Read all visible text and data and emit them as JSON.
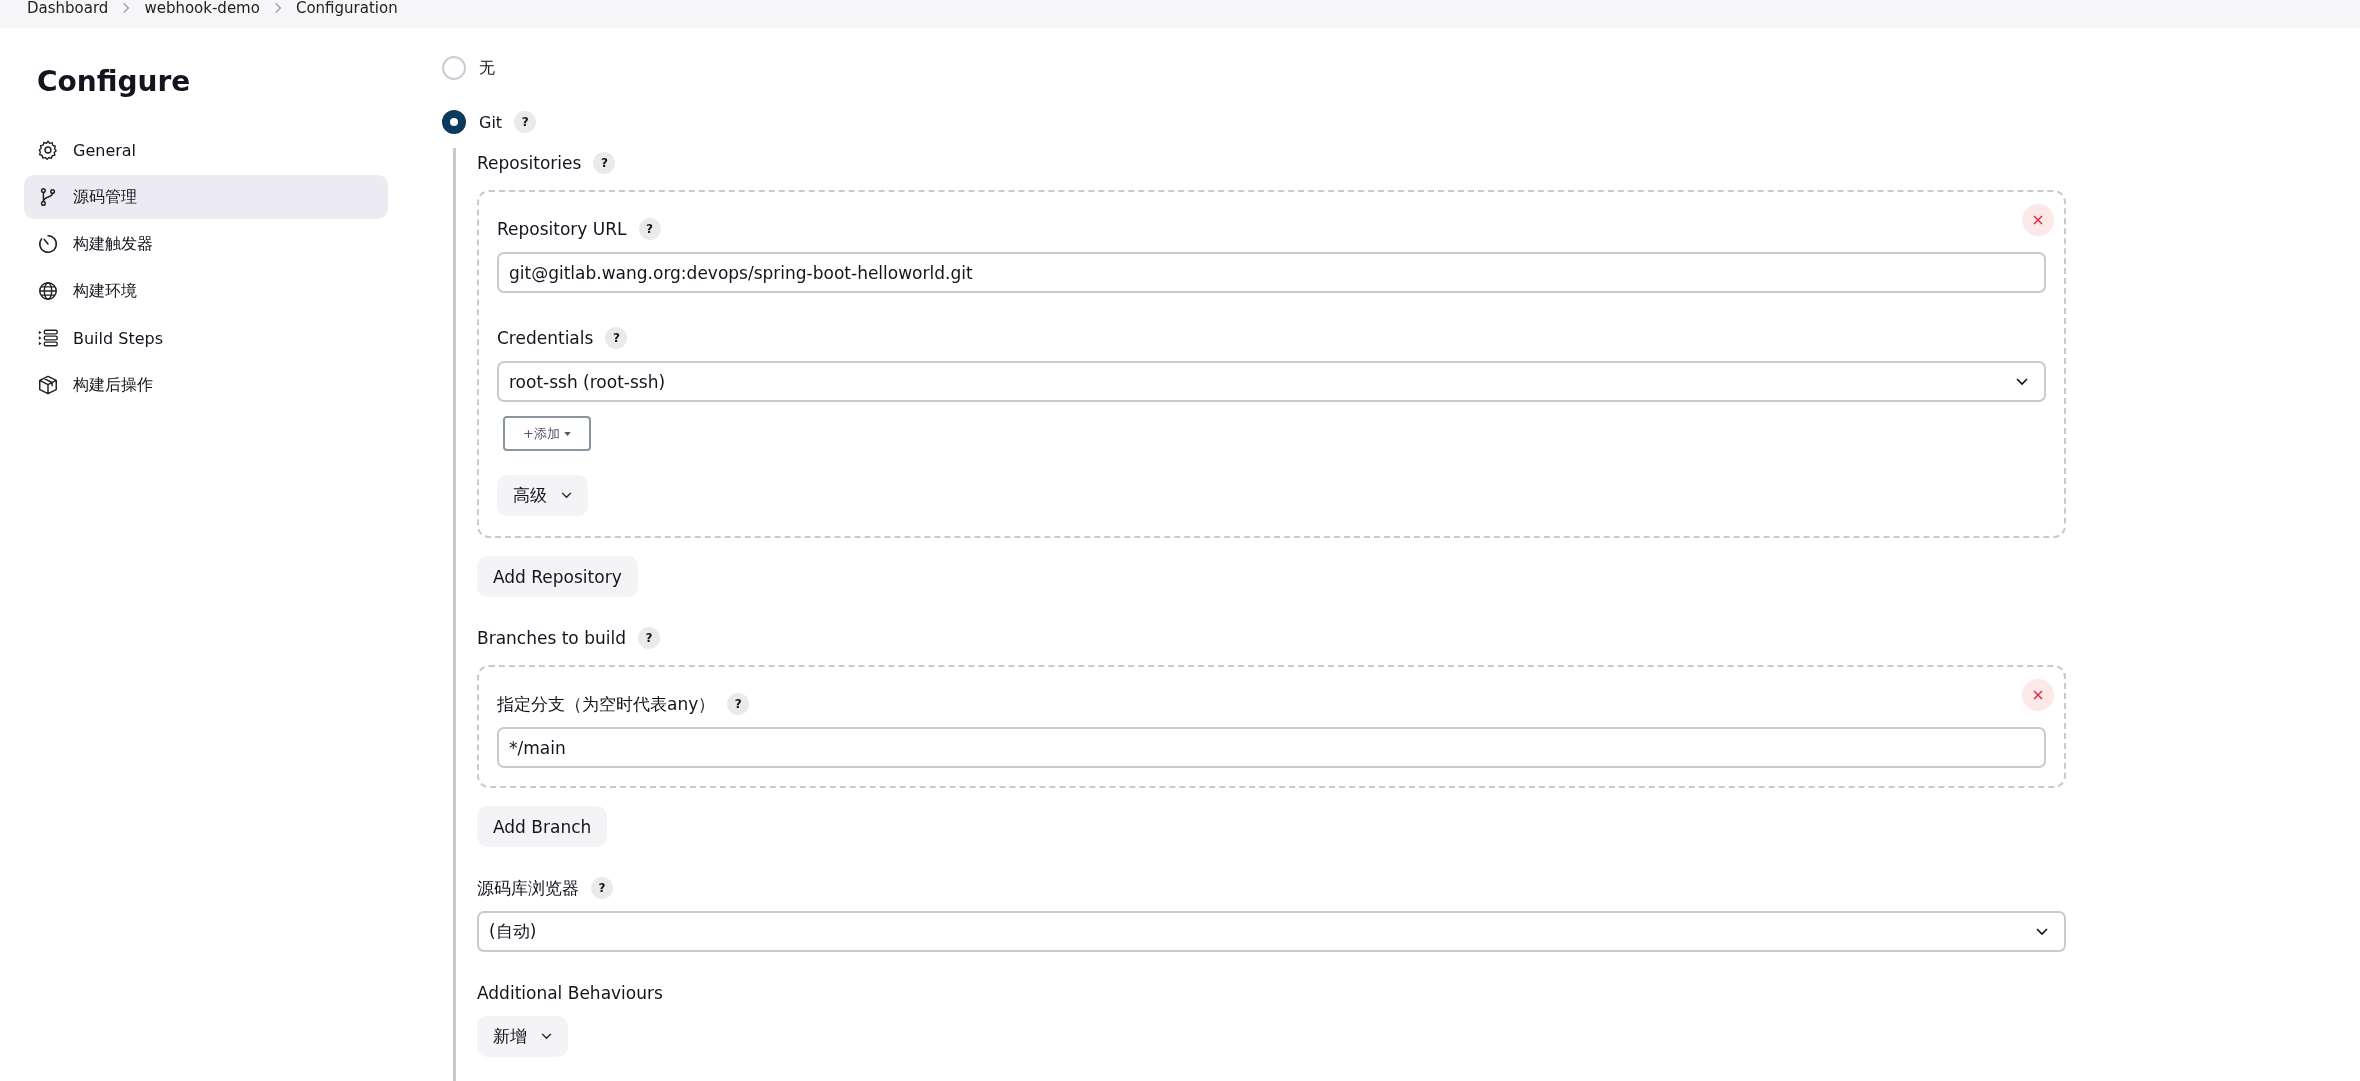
{
  "breadcrumb": [
    "Dashboard",
    "webhook-demo",
    "Configuration"
  ],
  "sidebar": {
    "title": "Configure",
    "items": [
      {
        "label": "General",
        "selected": false
      },
      {
        "label": "源码管理",
        "selected": true
      },
      {
        "label": "构建触发器",
        "selected": false
      },
      {
        "label": "构建环境",
        "selected": false
      },
      {
        "label": "Build Steps",
        "selected": false
      },
      {
        "label": "构建后操作",
        "selected": false
      }
    ]
  },
  "scm_options": [
    {
      "label": "无",
      "selected": false
    },
    {
      "label": "Git",
      "selected": true,
      "help": "?"
    }
  ],
  "repositories": {
    "label": "Repositories",
    "help": "?",
    "url_label": "Repository URL",
    "url_help": "?",
    "url": "git@gitlab.wang.org:devops/spring-boot-helloworld.git",
    "credentials_label": "Credentials",
    "credentials_help": "?",
    "credentials": "root-ssh (root-ssh)",
    "add_label": "+添加",
    "advanced_label": "高级",
    "add_repository": "Add Repository"
  },
  "branches": {
    "label": "Branches to build",
    "help": "?",
    "branch_label": "指定分支（为空时代表any）",
    "branch_help": "?",
    "branch": "*/main",
    "add_branch": "Add Branch"
  },
  "browser": {
    "label": "源码库浏览器",
    "help": "?",
    "value": "(自动)"
  },
  "behaviours": {
    "label": "Additional Behaviours",
    "add_label": "新增"
  }
}
